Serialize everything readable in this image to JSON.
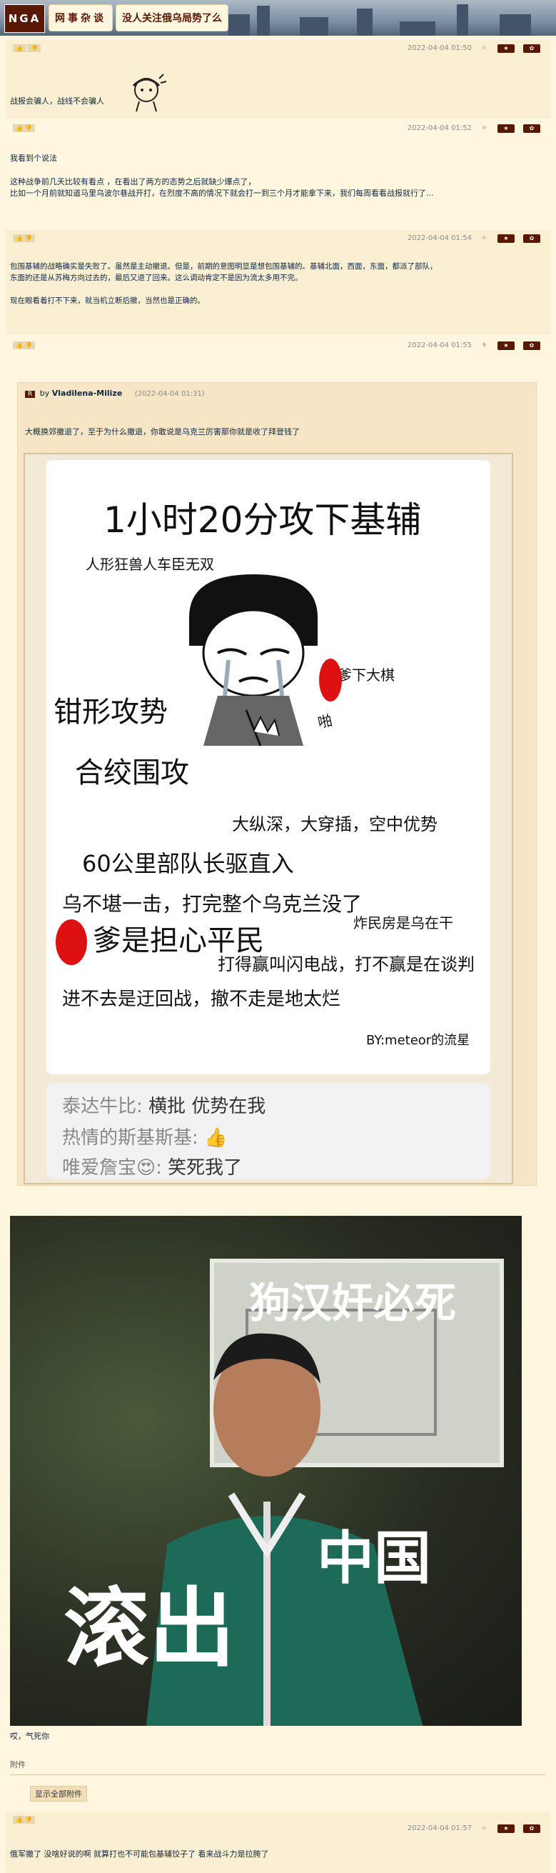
{
  "header": {
    "logo": "NGA",
    "section": "网事杂谈",
    "thread_title": "没人关注俄乌局势了么"
  },
  "posts": [
    {
      "time": "2022-04-04 01:50",
      "votes": "1",
      "lines": [
        "战报会骗人，战线不会骗人"
      ]
    },
    {
      "time": "2022-04-04 01:52",
      "votes": "",
      "lines": [
        "我看到个说法",
        "",
        "这种战争前几天比较有看点 ，在看出了两方的态势之后就缺少爆点了，",
        "比如一个月前就知道马里乌波尔巷战开打，在烈度不高的情况下就会打一到三个月才能拿下来，我们每周看看战报就行了..."
      ]
    },
    {
      "time": "2022-04-04 01:54",
      "votes": "",
      "lines": [
        "包围基辅的战略确实是失败了。虽然是主动撤退。但是，前期的意图明显是想包围基辅的。基辅北面，西面，东面，都派了部队，",
        "东面的还是从苏梅方向过去的，最后又退了回来。这么调动肯定不是因为流太多用不完。",
        "",
        "现在眼看着打不下来，就当机立断后撤，当然也是正确的。"
      ]
    },
    {
      "time": "2022-04-04 01:55",
      "votes": "",
      "lines": [
        "哎，气死你"
      ]
    },
    {
      "time": "2022-04-04 01:57",
      "votes": "",
      "lines": [
        "俄军撤了 没啥好说的啊 就算打也不可能包基辅饺子了 看来战斗力是拉胯了"
      ]
    }
  ],
  "quote": {
    "badge": "R",
    "by": "by",
    "author": "Vladilena-Milize",
    "date": "(2022-04-04 01:31)",
    "text": "大概换郊撤退了，至于为什么撤退，你敢说是乌克兰厉害那你就是收了拜登钱了"
  },
  "meme1": {
    "title": "1小时20分攻下基辅",
    "lines": [
      "人形狂兽人车臣无双",
      "爹下大棋",
      "啪",
      "钳形攻势",
      "合绞围攻",
      "大纵深，大穿插，空中优势",
      "60公里部队长驱直入",
      "乌不堪一击，打完整个乌克兰没了",
      "爹是担心平民",
      "炸民房是乌在干",
      "打得赢叫闪电战，打不赢是在谈判",
      "进不去是迂回战，撤不走是地太烂",
      "BY:meteor的流星"
    ],
    "chat": [
      {
        "name": "泰达牛比:",
        "msg": "横批 优势在我"
      },
      {
        "name": "热情的斯基斯基:",
        "msg": "👍"
      },
      {
        "name": "唯爱詹宝😍:",
        "msg": "笑死我了"
      }
    ]
  },
  "meme2": {
    "top_text": "狗汉奸必死",
    "bottom_text": "滚出",
    "jacket_text": "中国"
  },
  "attachments": {
    "label": "附件",
    "button": "显示全部附件"
  },
  "colors": {
    "accent": "#591804",
    "background": "#fff6df",
    "alt_background": "#fbefd3"
  }
}
